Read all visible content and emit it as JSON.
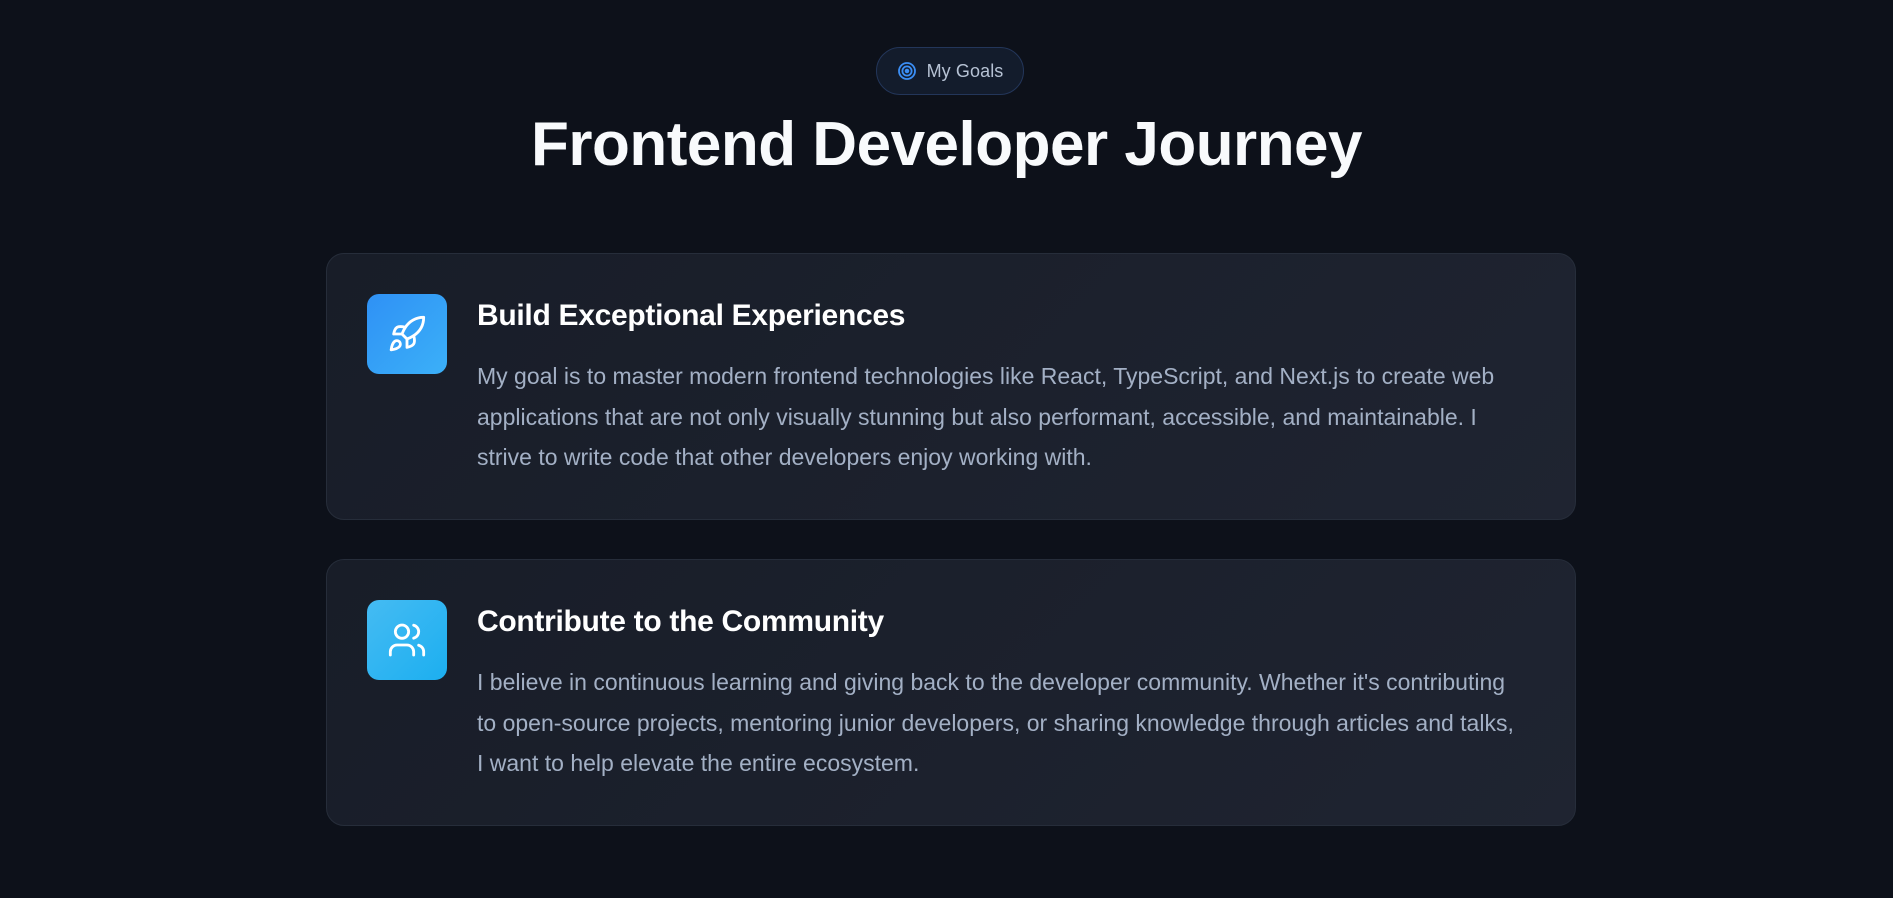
{
  "header": {
    "badge_label": "My Goals",
    "badge_icon": "target-icon",
    "title": "Frontend Developer Journey"
  },
  "goals": [
    {
      "icon": "rocket-icon",
      "title": "Build Exceptional Experiences",
      "description": "My goal is to master modern frontend technologies like React, TypeScript, and Next.js to create web applications that are not only visually stunning but also performant, accessible, and maintainable. I strive to write code that other developers enjoy working with."
    },
    {
      "icon": "users-icon",
      "title": "Contribute to the Community",
      "description": "I believe in continuous learning and giving back to the developer community. Whether it's contributing to open-source projects, mentoring junior developers, or sharing knowledge through articles and talks, I want to help elevate the entire ecosystem."
    }
  ],
  "colors": {
    "background": "#0d111a",
    "accent": "#2f91f5",
    "accent_alt": "#1caff0",
    "muted_text": "#a3b0c5"
  }
}
